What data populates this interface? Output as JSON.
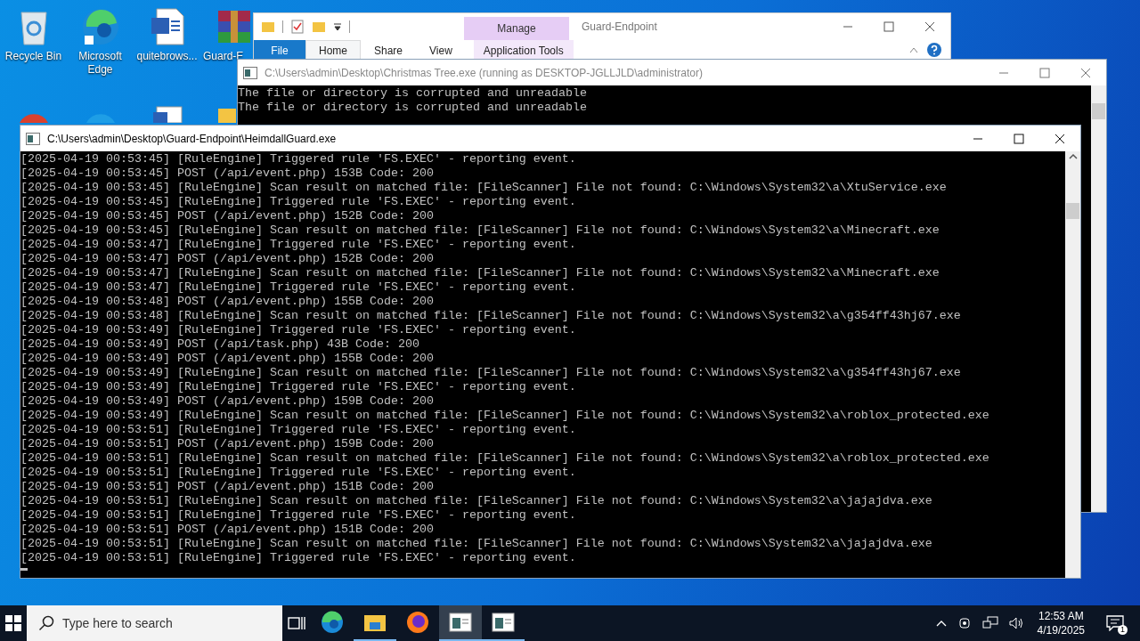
{
  "desktop_icons": [
    {
      "label": "Recycle Bin",
      "kind": "recycle"
    },
    {
      "label": "Microsoft Edge",
      "kind": "edge"
    },
    {
      "label": "quitebrows...",
      "kind": "word"
    },
    {
      "label": "Guard-E",
      "kind": "archive"
    }
  ],
  "explorer": {
    "title": "Guard-Endpoint",
    "context_tab": "Manage",
    "tabs": [
      {
        "label": "File",
        "kind": "file",
        "selected": false
      },
      {
        "label": "Home",
        "kind": "tab",
        "selected": true
      },
      {
        "label": "Share",
        "kind": "tab",
        "selected": false
      },
      {
        "label": "View",
        "kind": "tab",
        "selected": false
      },
      {
        "label": "Application Tools",
        "kind": "context",
        "selected": false
      }
    ]
  },
  "console_back": {
    "title": "C:\\Users\\admin\\Desktop\\Christmas Tree.exe (running as DESKTOP-JGLLJLD\\administrator)",
    "active": false,
    "lines": [
      "The file or directory is corrupted and unreadable",
      "The file or directory is corrupted and unreadable"
    ]
  },
  "console_front": {
    "title": "C:\\Users\\admin\\Desktop\\Guard-Endpoint\\HeimdallGuard.exe",
    "active": true,
    "lines": [
      "[2025-04-19 00:53:45] [RuleEngine] Triggered rule 'FS.EXEC' - reporting event.",
      "[2025-04-19 00:53:45] POST (/api/event.php) 153B Code: 200",
      "[2025-04-19 00:53:45] [RuleEngine] Scan result on matched file: [FileScanner] File not found: C:\\Windows\\System32\\a\\XtuService.exe",
      "[2025-04-19 00:53:45] [RuleEngine] Triggered rule 'FS.EXEC' - reporting event.",
      "[2025-04-19 00:53:45] POST (/api/event.php) 152B Code: 200",
      "[2025-04-19 00:53:45] [RuleEngine] Scan result on matched file: [FileScanner] File not found: C:\\Windows\\System32\\a\\Minecraft.exe",
      "[2025-04-19 00:53:47] [RuleEngine] Triggered rule 'FS.EXEC' - reporting event.",
      "[2025-04-19 00:53:47] POST (/api/event.php) 152B Code: 200",
      "[2025-04-19 00:53:47] [RuleEngine] Scan result on matched file: [FileScanner] File not found: C:\\Windows\\System32\\a\\Minecraft.exe",
      "[2025-04-19 00:53:47] [RuleEngine] Triggered rule 'FS.EXEC' - reporting event.",
      "[2025-04-19 00:53:48] POST (/api/event.php) 155B Code: 200",
      "[2025-04-19 00:53:48] [RuleEngine] Scan result on matched file: [FileScanner] File not found: C:\\Windows\\System32\\a\\g354ff43hj67.exe",
      "[2025-04-19 00:53:49] [RuleEngine] Triggered rule 'FS.EXEC' - reporting event.",
      "[2025-04-19 00:53:49] POST (/api/task.php) 43B Code: 200",
      "[2025-04-19 00:53:49] POST (/api/event.php) 155B Code: 200",
      "[2025-04-19 00:53:49] [RuleEngine] Scan result on matched file: [FileScanner] File not found: C:\\Windows\\System32\\a\\g354ff43hj67.exe",
      "[2025-04-19 00:53:49] [RuleEngine] Triggered rule 'FS.EXEC' - reporting event.",
      "[2025-04-19 00:53:49] POST (/api/event.php) 159B Code: 200",
      "[2025-04-19 00:53:49] [RuleEngine] Scan result on matched file: [FileScanner] File not found: C:\\Windows\\System32\\a\\roblox_protected.exe",
      "[2025-04-19 00:53:51] [RuleEngine] Triggered rule 'FS.EXEC' - reporting event.",
      "[2025-04-19 00:53:51] POST (/api/event.php) 159B Code: 200",
      "[2025-04-19 00:53:51] [RuleEngine] Scan result on matched file: [FileScanner] File not found: C:\\Windows\\System32\\a\\roblox_protected.exe",
      "[2025-04-19 00:53:51] [RuleEngine] Triggered rule 'FS.EXEC' - reporting event.",
      "[2025-04-19 00:53:51] POST (/api/event.php) 151B Code: 200",
      "[2025-04-19 00:53:51] [RuleEngine] Scan result on matched file: [FileScanner] File not found: C:\\Windows\\System32\\a\\jajajdva.exe",
      "[2025-04-19 00:53:51] [RuleEngine] Triggered rule 'FS.EXEC' - reporting event.",
      "[2025-04-19 00:53:51] POST (/api/event.php) 151B Code: 200",
      "[2025-04-19 00:53:51] [RuleEngine] Scan result on matched file: [FileScanner] File not found: C:\\Windows\\System32\\a\\jajajdva.exe",
      "[2025-04-19 00:53:51] [RuleEngine] Triggered rule 'FS.EXEC' - reporting event."
    ]
  },
  "taskbar": {
    "search": {
      "placeholder": "Type here to search"
    },
    "apps": [
      {
        "kind": "edge",
        "selected": false,
        "running": false
      },
      {
        "kind": "explorer",
        "selected": false,
        "running": true
      },
      {
        "kind": "firefox",
        "selected": false,
        "running": false
      },
      {
        "kind": "console",
        "selected": true,
        "running": true
      },
      {
        "kind": "console",
        "selected": false,
        "running": true
      }
    ],
    "time": "12:53 AM",
    "date": "4/19/2025",
    "notifications": "1"
  }
}
